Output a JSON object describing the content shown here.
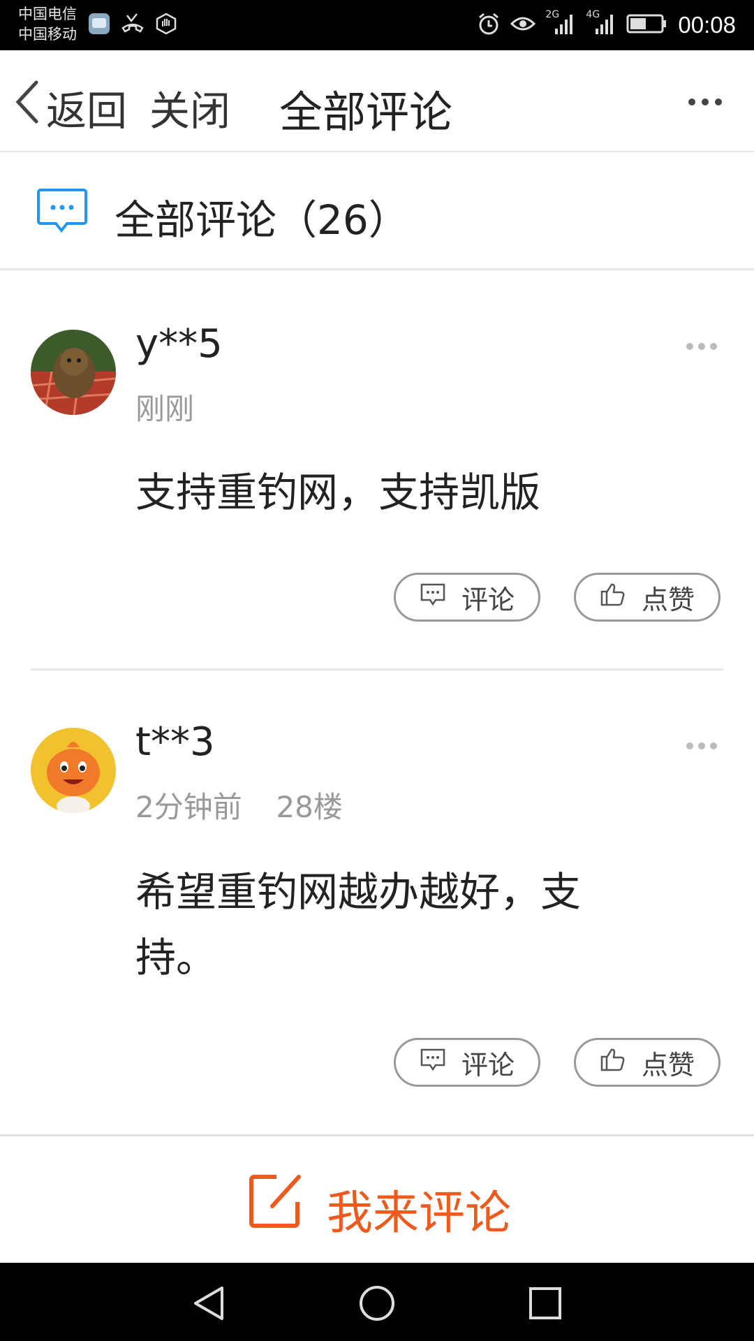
{
  "status_bar": {
    "carrier_1": "中国电信",
    "carrier_2": "中国移动",
    "network_1": "2G",
    "network_2": "4G",
    "time": "00:08",
    "icons": [
      "app-icon",
      "missed-call-icon",
      "hand-icon",
      "alarm-icon",
      "eye-icon",
      "signal-icon",
      "signal-icon",
      "battery-icon"
    ]
  },
  "nav": {
    "back_label": "返回",
    "close_label": "关闭",
    "title": "全部评论",
    "more_icon": "more-icon"
  },
  "section": {
    "title": "全部评论（26）",
    "icon": "chat-bubble-icon",
    "accent": "#2196f3"
  },
  "comments": [
    {
      "user": "y**5",
      "time": "刚刚",
      "floor": "",
      "text": "支持重钓网，支持凯版",
      "comment_label": "评论",
      "like_label": "点赞"
    },
    {
      "user": "t**3",
      "time": "2分钟前",
      "floor": "28楼",
      "text": "希望重钓网越办越好，支持。",
      "comment_label": "评论",
      "like_label": "点赞"
    }
  ],
  "bottom_bar": {
    "label": "我来评论",
    "icon": "edit-icon",
    "color": "#ee5a1c"
  },
  "android_nav": {
    "icons": [
      "back-triangle-icon",
      "home-circle-icon",
      "recents-square-icon"
    ]
  }
}
